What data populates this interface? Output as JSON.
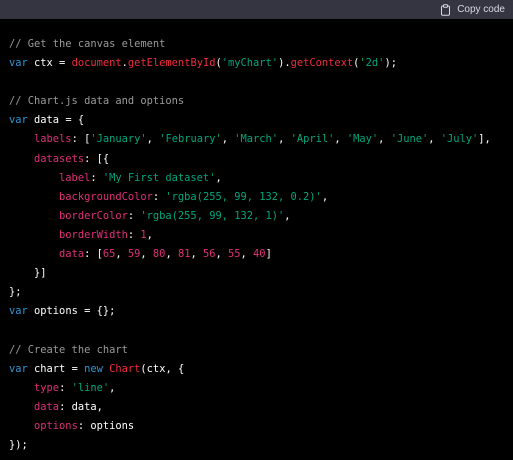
{
  "header": {
    "copy_label": "Copy code",
    "colors": {
      "bar": "#343541",
      "text": "#d9d9e3"
    }
  },
  "code_colors": {
    "comment": "#9a9a9a",
    "keyword": "#2e95d3",
    "string": "#00a67d",
    "number": "#df3079",
    "function": "#f22c3d",
    "property": "#df3079",
    "plain": "#ffffff"
  },
  "code_lines": [
    [
      {
        "t": "// Get the canvas element",
        "c": "cm"
      }
    ],
    [
      {
        "t": "var",
        "c": "kw"
      },
      {
        "t": " ctx = ",
        "c": "pl"
      },
      {
        "t": "document",
        "c": "fn"
      },
      {
        "t": ".",
        "c": "pl"
      },
      {
        "t": "getElementById",
        "c": "fn"
      },
      {
        "t": "(",
        "c": "pl"
      },
      {
        "t": "'myChart'",
        "c": "str"
      },
      {
        "t": ").",
        "c": "pl"
      },
      {
        "t": "getContext",
        "c": "fn"
      },
      {
        "t": "(",
        "c": "pl"
      },
      {
        "t": "'2d'",
        "c": "str"
      },
      {
        "t": ");",
        "c": "pl"
      }
    ],
    [],
    [
      {
        "t": "// Chart.js data and options",
        "c": "cm"
      }
    ],
    [
      {
        "t": "var",
        "c": "kw"
      },
      {
        "t": " data = {",
        "c": "pl"
      }
    ],
    [
      {
        "t": "    ",
        "c": "pl"
      },
      {
        "t": "labels",
        "c": "prop"
      },
      {
        "t": ": [",
        "c": "pl"
      },
      {
        "t": "'January'",
        "c": "str"
      },
      {
        "t": ", ",
        "c": "pl"
      },
      {
        "t": "'February'",
        "c": "str"
      },
      {
        "t": ", ",
        "c": "pl"
      },
      {
        "t": "'March'",
        "c": "str"
      },
      {
        "t": ", ",
        "c": "pl"
      },
      {
        "t": "'April'",
        "c": "str"
      },
      {
        "t": ", ",
        "c": "pl"
      },
      {
        "t": "'May'",
        "c": "str"
      },
      {
        "t": ", ",
        "c": "pl"
      },
      {
        "t": "'June'",
        "c": "str"
      },
      {
        "t": ", ",
        "c": "pl"
      },
      {
        "t": "'July'",
        "c": "str"
      },
      {
        "t": "],",
        "c": "pl"
      }
    ],
    [
      {
        "t": "    ",
        "c": "pl"
      },
      {
        "t": "datasets",
        "c": "prop"
      },
      {
        "t": ": [{",
        "c": "pl"
      }
    ],
    [
      {
        "t": "        ",
        "c": "pl"
      },
      {
        "t": "label",
        "c": "prop"
      },
      {
        "t": ": ",
        "c": "pl"
      },
      {
        "t": "'My First dataset'",
        "c": "str"
      },
      {
        "t": ",",
        "c": "pl"
      }
    ],
    [
      {
        "t": "        ",
        "c": "pl"
      },
      {
        "t": "backgroundColor",
        "c": "prop"
      },
      {
        "t": ": ",
        "c": "pl"
      },
      {
        "t": "'rgba(255, 99, 132, 0.2)'",
        "c": "str"
      },
      {
        "t": ",",
        "c": "pl"
      }
    ],
    [
      {
        "t": "        ",
        "c": "pl"
      },
      {
        "t": "borderColor",
        "c": "prop"
      },
      {
        "t": ": ",
        "c": "pl"
      },
      {
        "t": "'rgba(255, 99, 132, 1)'",
        "c": "str"
      },
      {
        "t": ",",
        "c": "pl"
      }
    ],
    [
      {
        "t": "        ",
        "c": "pl"
      },
      {
        "t": "borderWidth",
        "c": "prop"
      },
      {
        "t": ": ",
        "c": "pl"
      },
      {
        "t": "1",
        "c": "num"
      },
      {
        "t": ",",
        "c": "pl"
      }
    ],
    [
      {
        "t": "        ",
        "c": "pl"
      },
      {
        "t": "data",
        "c": "prop"
      },
      {
        "t": ": [",
        "c": "pl"
      },
      {
        "t": "65",
        "c": "num"
      },
      {
        "t": ", ",
        "c": "pl"
      },
      {
        "t": "59",
        "c": "num"
      },
      {
        "t": ", ",
        "c": "pl"
      },
      {
        "t": "80",
        "c": "num"
      },
      {
        "t": ", ",
        "c": "pl"
      },
      {
        "t": "81",
        "c": "num"
      },
      {
        "t": ", ",
        "c": "pl"
      },
      {
        "t": "56",
        "c": "num"
      },
      {
        "t": ", ",
        "c": "pl"
      },
      {
        "t": "55",
        "c": "num"
      },
      {
        "t": ", ",
        "c": "pl"
      },
      {
        "t": "40",
        "c": "num"
      },
      {
        "t": "]",
        "c": "pl"
      }
    ],
    [
      {
        "t": "    }]",
        "c": "pl"
      }
    ],
    [
      {
        "t": "};",
        "c": "pl"
      }
    ],
    [
      {
        "t": "var",
        "c": "kw"
      },
      {
        "t": " options = {};",
        "c": "pl"
      }
    ],
    [],
    [
      {
        "t": "// Create the chart",
        "c": "cm"
      }
    ],
    [
      {
        "t": "var",
        "c": "kw"
      },
      {
        "t": " chart = ",
        "c": "pl"
      },
      {
        "t": "new",
        "c": "kw"
      },
      {
        "t": " ",
        "c": "pl"
      },
      {
        "t": "Chart",
        "c": "fn"
      },
      {
        "t": "(ctx, {",
        "c": "pl"
      }
    ],
    [
      {
        "t": "    ",
        "c": "pl"
      },
      {
        "t": "type",
        "c": "prop"
      },
      {
        "t": ": ",
        "c": "pl"
      },
      {
        "t": "'line'",
        "c": "str"
      },
      {
        "t": ",",
        "c": "pl"
      }
    ],
    [
      {
        "t": "    ",
        "c": "pl"
      },
      {
        "t": "data",
        "c": "prop"
      },
      {
        "t": ": data,",
        "c": "pl"
      }
    ],
    [
      {
        "t": "    ",
        "c": "pl"
      },
      {
        "t": "options",
        "c": "prop"
      },
      {
        "t": ": options",
        "c": "pl"
      }
    ],
    [
      {
        "t": "});",
        "c": "pl"
      }
    ]
  ]
}
